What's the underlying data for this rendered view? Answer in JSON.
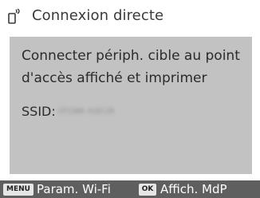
{
  "header": {
    "icon": "wireless-print-icon",
    "title": "Connexion directe"
  },
  "panel": {
    "message": "Connecter périph. cible au point d'accès affiché et imprimer",
    "ssid_label": "SSID:",
    "ssid_value": "CP1300-A1EC20",
    "background_color": "#c2c2c2"
  },
  "footer": {
    "menu_key": "MENU",
    "menu_label": "Param. Wi-Fi",
    "ok_key": "OK",
    "ok_label": "Affich. MdP",
    "background_color": "#5f5f5f"
  }
}
